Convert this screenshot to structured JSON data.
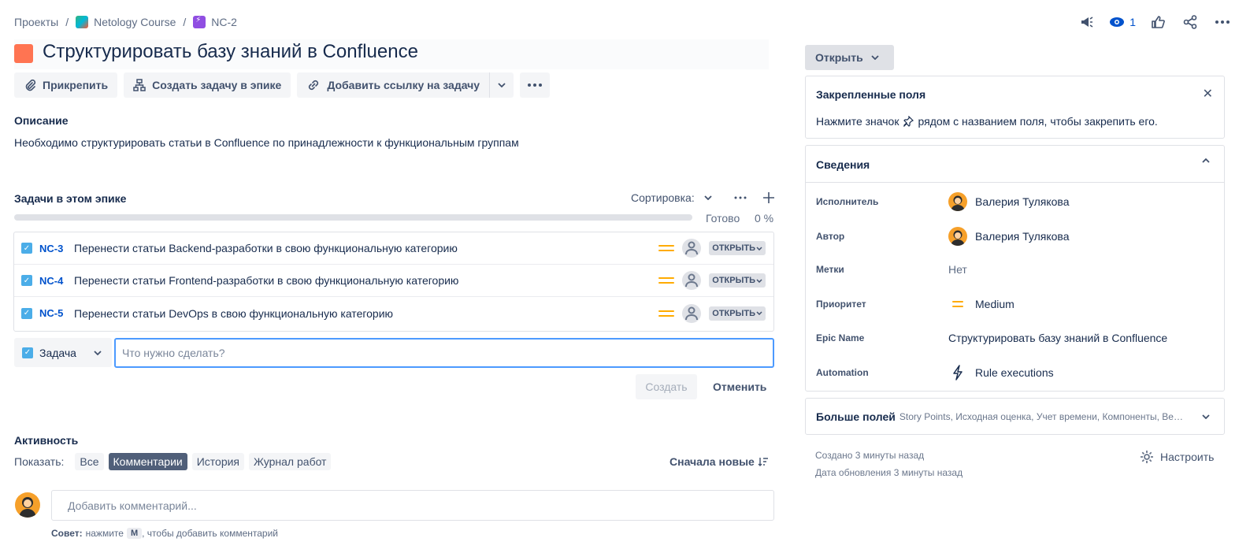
{
  "breadcrumbs": {
    "projects": "Проекты",
    "project": "Netology Course",
    "issue": "NC-2",
    "separator": "/"
  },
  "top_actions": {
    "watchers_count": "1",
    "icons": [
      "megaphone-icon",
      "eye-icon",
      "thumbs-up-icon",
      "share-icon",
      "more-icon"
    ]
  },
  "issue": {
    "title": "Структурировать базу знаний в Confluence",
    "type_color": "#ff7452"
  },
  "toolbar": {
    "attach": "Прикрепить",
    "create_task": "Создать задачу в эпике",
    "add_link": "Добавить ссылку на задачу"
  },
  "description": {
    "heading": "Описание",
    "text": "Необходимо структурировать статьи в Confluence по принадлежности к функциональным группам"
  },
  "epic_tasks": {
    "heading": "Задачи в этом эпике",
    "sort_label": "Сортировка:",
    "done_label": "Готово",
    "done_percent": "0 %",
    "progress_fraction": 0,
    "rows": [
      {
        "key": "NC-3",
        "summary": "Перенести статьи Backend-разработки в свою функциональную категорию",
        "status": "ОТКРЫТЬ"
      },
      {
        "key": "NC-4",
        "summary": "Перенести статьи Frontend-разработки в свою функциональную категорию",
        "status": "ОТКРЫТЬ"
      },
      {
        "key": "NC-5",
        "summary": "Перенести статьи DevOps в свою функциональную категорию",
        "status": "ОТКРЫТЬ"
      }
    ],
    "create": {
      "type": "Задача",
      "placeholder": "Что нужно сделать?",
      "create_btn": "Создать",
      "cancel_btn": "Отменить"
    }
  },
  "activity": {
    "heading": "Активность",
    "show_label": "Показать:",
    "tabs": [
      "Все",
      "Комментарии",
      "История",
      "Журнал работ"
    ],
    "active_tab": "Комментарии",
    "order": "Сначала новые",
    "comment_placeholder": "Добавить комментарий...",
    "tip_label": "Совет:",
    "tip_press": "нажмите",
    "tip_key": "M",
    "tip_rest": ", чтобы добавить комментарий"
  },
  "sidebar": {
    "status": "Открыть",
    "pinned": {
      "heading": "Закрепленные поля",
      "text_before": "Нажмите значок",
      "text_after": "рядом с названием поля, чтобы закрепить его."
    },
    "details": {
      "heading": "Сведения",
      "fields": [
        {
          "label": "Исполнитель",
          "value": "Валерия Тулякова"
        },
        {
          "label": "Автор",
          "value": "Валерия Тулякова"
        },
        {
          "label": "Метки",
          "value": "Нет"
        },
        {
          "label": "Приоритет",
          "value": "Medium"
        },
        {
          "label": "Epic Name",
          "value": "Структурировать базу знаний в Confluence"
        },
        {
          "label": "Automation",
          "value": "Rule executions"
        }
      ]
    },
    "more_fields": {
      "heading": "Больше полей",
      "list": "Story Points, Исходная оценка, Учет времени, Компоненты, Вер..."
    },
    "created": "Создано 3 минуты назад",
    "updated": "Дата обновления 3 минуты назад",
    "configure": "Настроить"
  }
}
